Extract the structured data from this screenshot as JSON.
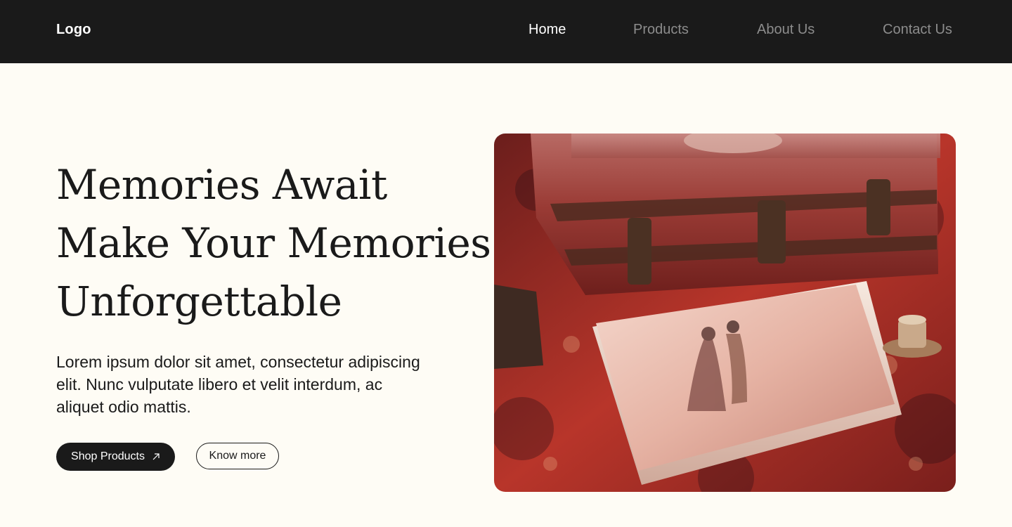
{
  "nav": {
    "logo": "Logo",
    "links": [
      {
        "label": "Home",
        "active": true
      },
      {
        "label": "Products",
        "active": false
      },
      {
        "label": "About Us",
        "active": false
      },
      {
        "label": "Contact Us",
        "active": false
      }
    ]
  },
  "hero": {
    "headline_lines": [
      "Memories Await",
      "Make Your Memories",
      "Unforgettable"
    ],
    "description": "Lorem ipsum dolor sit amet, consectetur adipiscing elit. Nunc vulputate libero et velit interdum, ac aliquet odio mattis.",
    "primary_button": "Shop Products",
    "primary_button_icon": "arrow-up-right-icon",
    "secondary_button": "Know more"
  },
  "colors": {
    "nav_background": "#1A1A1A",
    "page_background": "#FEFCF5",
    "accent": "#1A1A1A"
  }
}
